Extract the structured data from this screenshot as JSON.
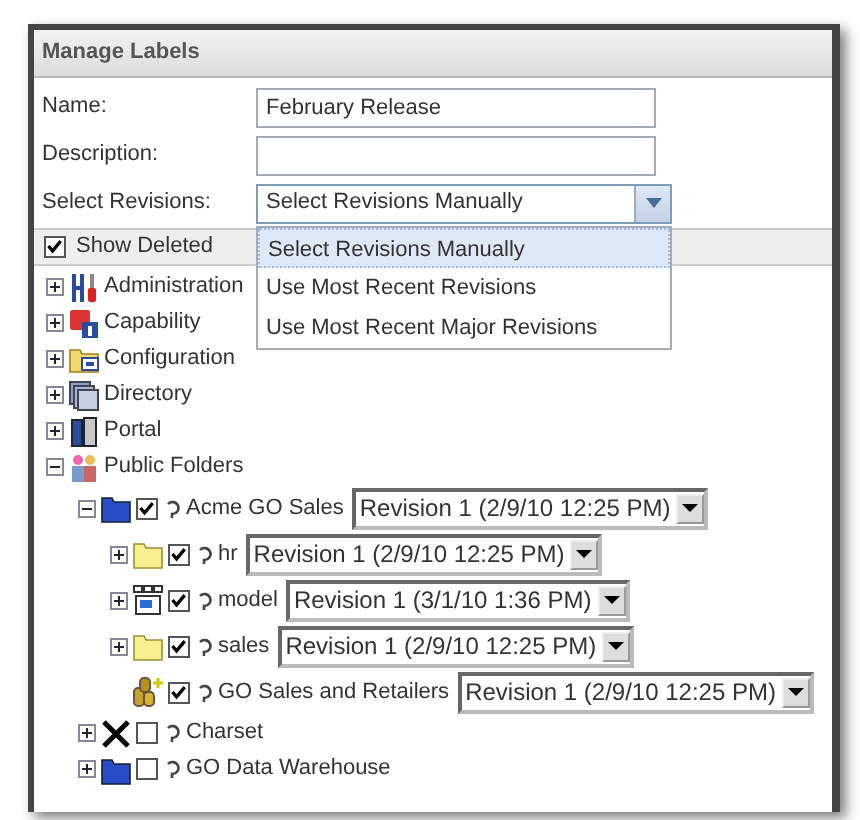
{
  "dialog": {
    "title": "Manage Labels"
  },
  "form": {
    "name": {
      "label": "Name:",
      "value": "February Release"
    },
    "description": {
      "label": "Description:"
    },
    "revisions": {
      "label": "Select Revisions:",
      "value": "Select Revisions Manually",
      "expanded": true,
      "options": [
        {
          "label": "Select Revisions Manually",
          "selected": true
        },
        {
          "label": "Use Most Recent Revisions",
          "selected": false
        },
        {
          "label": "Use Most Recent Major Revisions",
          "selected": false
        }
      ]
    }
  },
  "show_deleted": {
    "label": "Show Deleted",
    "checked": true
  },
  "tree": [
    {
      "label": "Administration",
      "kind": "tools",
      "expanded": false
    },
    {
      "label": "Capability",
      "kind": "capability",
      "expanded": false
    },
    {
      "label": "Configuration",
      "kind": "configuration",
      "expanded": false
    },
    {
      "label": "Directory",
      "kind": "directory",
      "expanded": false
    },
    {
      "label": "Portal",
      "kind": "portal",
      "expanded": false
    },
    {
      "label": "Public Folders",
      "kind": "people",
      "expanded": true,
      "children": [
        {
          "label": "Acme GO Sales",
          "kind": "package",
          "expanded": true,
          "checked": true,
          "revision": "Revision 1 (2/9/10 12:25 PM)",
          "children": [
            {
              "label": "hr",
              "kind": "folder",
              "expanded": false,
              "checked": true,
              "revision": "Revision 1 (2/9/10 12:25 PM)"
            },
            {
              "label": "model",
              "kind": "model",
              "expanded": false,
              "checked": true,
              "revision": "Revision 1 (3/1/10 1:36 PM)"
            },
            {
              "label": "sales",
              "kind": "folder",
              "expanded": false,
              "checked": true,
              "revision": "Revision 1 (2/9/10 12:25 PM)"
            },
            {
              "label": "GO Sales and Retailers",
              "kind": "datasource",
              "checked": true,
              "revision": "Revision 1 (2/9/10 12:25 PM)"
            }
          ]
        },
        {
          "label": "Charset",
          "kind": "cross",
          "expanded": false,
          "checked": false
        },
        {
          "label": "GO Data Warehouse",
          "kind": "package",
          "expanded": false,
          "checked": false
        }
      ]
    }
  ]
}
